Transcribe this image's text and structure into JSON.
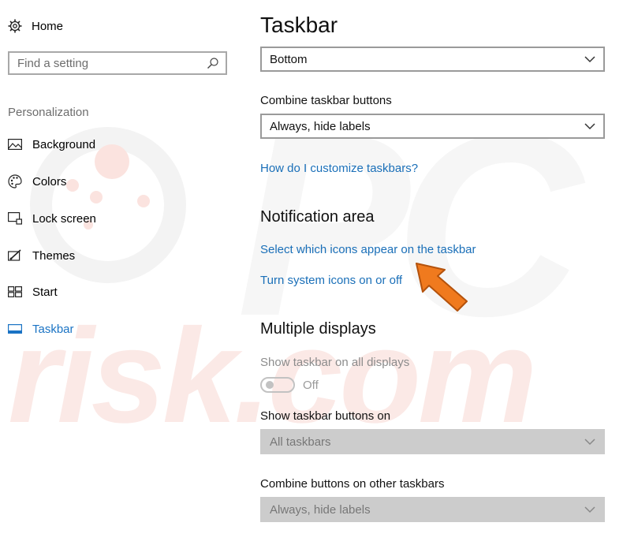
{
  "watermark": {
    "text": "risk.com",
    "letters": "PC"
  },
  "sidebar": {
    "home_label": "Home",
    "search_placeholder": "Find a setting",
    "section_label": "Personalization",
    "items": [
      {
        "label": "Background",
        "icon": "picture-icon",
        "active": false
      },
      {
        "label": "Colors",
        "icon": "palette-icon",
        "active": false
      },
      {
        "label": "Lock screen",
        "icon": "lock-screen-icon",
        "active": false
      },
      {
        "label": "Themes",
        "icon": "themes-icon",
        "active": false
      },
      {
        "label": "Start",
        "icon": "start-icon",
        "active": false
      },
      {
        "label": "Taskbar",
        "icon": "taskbar-icon",
        "active": true
      }
    ]
  },
  "main": {
    "title": "Taskbar",
    "location_dropdown": {
      "value": "Bottom"
    },
    "combine_label": "Combine taskbar buttons",
    "combine_dropdown": {
      "value": "Always, hide labels"
    },
    "customize_link": "How do I customize taskbars?",
    "notification_heading": "Notification area",
    "select_icons_link": "Select which icons appear on the taskbar",
    "system_icons_link": "Turn system icons on or off",
    "multiple_heading": "Multiple displays",
    "show_all_label": "Show taskbar on all displays",
    "show_all_toggle": "Off",
    "show_buttons_label": "Show taskbar buttons on",
    "show_buttons_dropdown": {
      "value": "All taskbars"
    },
    "combine_other_label": "Combine buttons on other taskbars",
    "combine_other_dropdown": {
      "value": "Always, hide labels"
    }
  },
  "colors": {
    "accent": "#1a73c4",
    "link": "#1a6fb8",
    "arrow": "#f07a1e",
    "disabled_bg": "#cccccc"
  }
}
